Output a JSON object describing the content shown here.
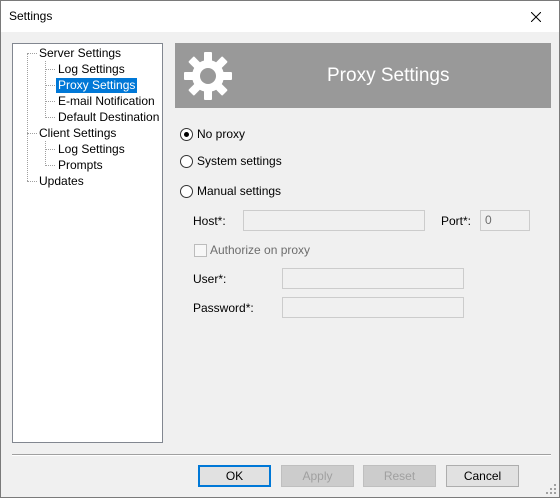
{
  "window": {
    "title": "Settings"
  },
  "tree": {
    "items": [
      {
        "label": "Server Settings"
      },
      {
        "label": "Log Settings"
      },
      {
        "label": "Proxy Settings"
      },
      {
        "label": "E-mail Notification"
      },
      {
        "label": "Default Destination"
      },
      {
        "label": "Client Settings"
      },
      {
        "label": "Log Settings"
      },
      {
        "label": "Prompts"
      },
      {
        "label": "Updates"
      }
    ],
    "selected": "Proxy Settings"
  },
  "header": {
    "title": "Proxy Settings",
    "icon": "gear-icon"
  },
  "proxy": {
    "options": [
      {
        "label": "No proxy",
        "checked": true
      },
      {
        "label": "System settings",
        "checked": false
      },
      {
        "label": "Manual settings",
        "checked": false
      }
    ],
    "host_label": "Host*:",
    "host_value": "",
    "port_label": "Port*:",
    "port_value": "0",
    "authorize_label": "Authorize on proxy",
    "user_label": "User*:",
    "user_value": "",
    "password_label": "Password*:",
    "password_value": ""
  },
  "buttons": {
    "ok": "OK",
    "apply": "Apply",
    "reset": "Reset",
    "cancel": "Cancel"
  }
}
